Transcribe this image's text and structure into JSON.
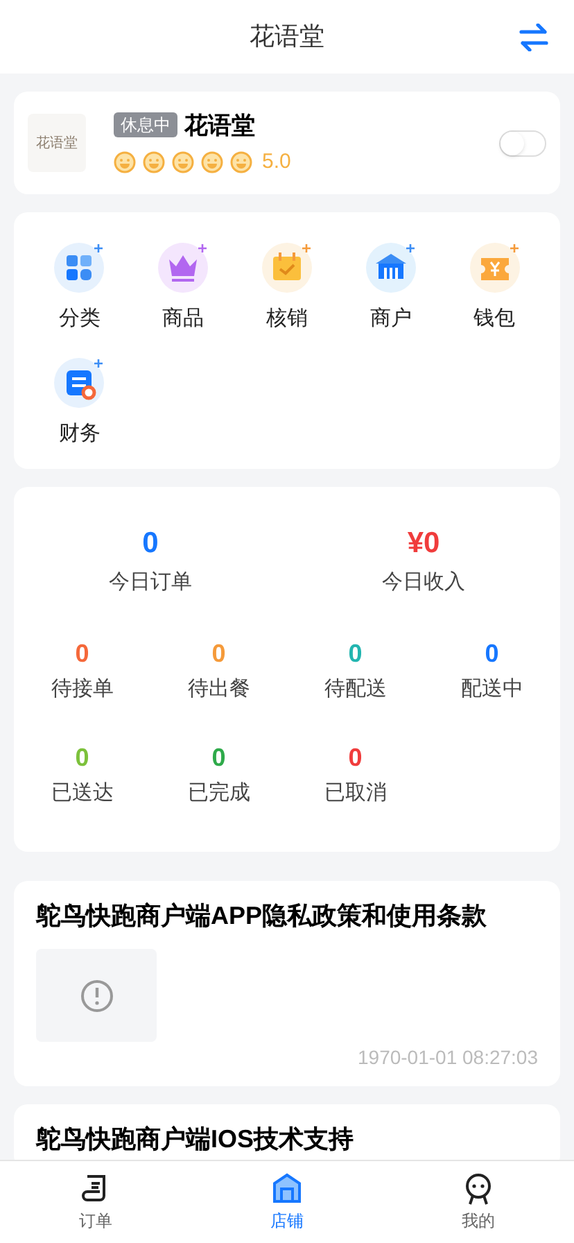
{
  "header": {
    "title": "花语堂"
  },
  "store": {
    "logo_text": "花语堂",
    "badge": "休息中",
    "name": "花语堂",
    "stars": 5,
    "rating": "5.0",
    "open": false
  },
  "menu": [
    {
      "label": "分类",
      "kind": "category"
    },
    {
      "label": "商品",
      "kind": "goods"
    },
    {
      "label": "核销",
      "kind": "verify"
    },
    {
      "label": "商户",
      "kind": "merchant"
    },
    {
      "label": "钱包",
      "kind": "wallet"
    },
    {
      "label": "财务",
      "kind": "finance"
    }
  ],
  "summary": [
    {
      "value": "0",
      "label": "今日订单",
      "color": "#1677ff"
    },
    {
      "value": "¥0",
      "label": "今日收入",
      "color": "#f03c3c"
    }
  ],
  "order_stats": [
    {
      "value": "0",
      "label": "待接单",
      "color": "#f5683a"
    },
    {
      "value": "0",
      "label": "待出餐",
      "color": "#f59a3a"
    },
    {
      "value": "0",
      "label": "待配送",
      "color": "#22b5b0"
    },
    {
      "value": "0",
      "label": "配送中",
      "color": "#1677ff"
    },
    {
      "value": "0",
      "label": "已送达",
      "color": "#7cc13b"
    },
    {
      "value": "0",
      "label": "已完成",
      "color": "#2eaa4a"
    },
    {
      "value": "0",
      "label": "已取消",
      "color": "#f03c3c"
    }
  ],
  "articles": [
    {
      "title": "鸵鸟快跑商户端APP隐私政策和使用条款",
      "image": true,
      "time": "1970-01-01 08:27:03"
    },
    {
      "title": "鸵鸟快跑商户端IOS技术支持"
    }
  ],
  "tab_bar": [
    {
      "label": "订单",
      "kind": "orders",
      "selected": false
    },
    {
      "label": "店铺",
      "kind": "shop",
      "selected": true
    },
    {
      "label": "我的",
      "kind": "me",
      "selected": false
    }
  ]
}
